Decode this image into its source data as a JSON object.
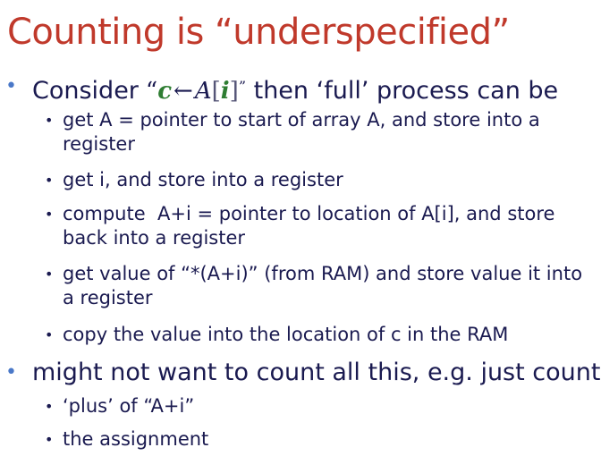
{
  "title": "Counting is “underspecified”",
  "bullets": [
    {
      "pre": "Consider",
      "formula": {
        "open_quote": "“",
        "var": "c",
        "arrow": "←",
        "array": "A",
        "lbracket": "[",
        "index": "i",
        "rbracket": "]",
        "close_quote": "”"
      },
      "post": "then ‘full’ process can be",
      "children": [
        "get A = pointer to start of array A, and store into a register",
        "get i, and store into a register",
        "compute  A+i = pointer to location of A[i], and store back into a register",
        "get value of “*(A+i)” (from RAM) and store value it into a register",
        "copy the value into the location of c in the RAM"
      ]
    },
    {
      "text": "might not want to count all this, e.g. just count",
      "children": [
        "‘plus’ of “A+i”",
        "the assignment"
      ]
    }
  ]
}
